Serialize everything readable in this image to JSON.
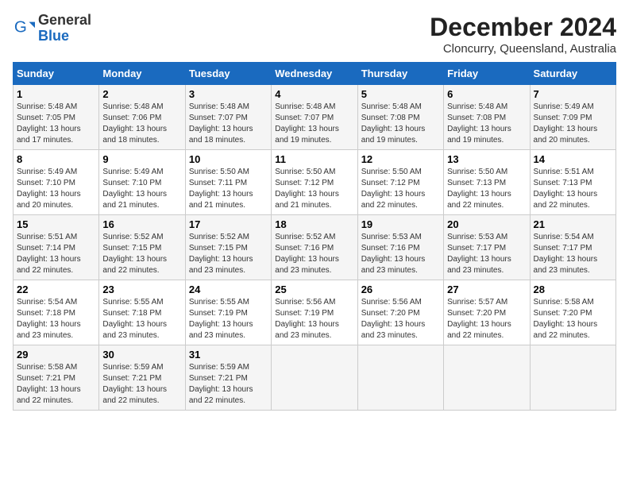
{
  "header": {
    "logo_line1": "General",
    "logo_line2": "Blue",
    "month_title": "December 2024",
    "location": "Cloncurry, Queensland, Australia"
  },
  "weekdays": [
    "Sunday",
    "Monday",
    "Tuesday",
    "Wednesday",
    "Thursday",
    "Friday",
    "Saturday"
  ],
  "weeks": [
    [
      {
        "day": "1",
        "sunrise": "5:48 AM",
        "sunset": "7:05 PM",
        "daylight": "13 hours and 17 minutes."
      },
      {
        "day": "2",
        "sunrise": "5:48 AM",
        "sunset": "7:06 PM",
        "daylight": "13 hours and 18 minutes."
      },
      {
        "day": "3",
        "sunrise": "5:48 AM",
        "sunset": "7:07 PM",
        "daylight": "13 hours and 18 minutes."
      },
      {
        "day": "4",
        "sunrise": "5:48 AM",
        "sunset": "7:07 PM",
        "daylight": "13 hours and 19 minutes."
      },
      {
        "day": "5",
        "sunrise": "5:48 AM",
        "sunset": "7:08 PM",
        "daylight": "13 hours and 19 minutes."
      },
      {
        "day": "6",
        "sunrise": "5:48 AM",
        "sunset": "7:08 PM",
        "daylight": "13 hours and 19 minutes."
      },
      {
        "day": "7",
        "sunrise": "5:49 AM",
        "sunset": "7:09 PM",
        "daylight": "13 hours and 20 minutes."
      }
    ],
    [
      {
        "day": "8",
        "sunrise": "5:49 AM",
        "sunset": "7:10 PM",
        "daylight": "13 hours and 20 minutes."
      },
      {
        "day": "9",
        "sunrise": "5:49 AM",
        "sunset": "7:10 PM",
        "daylight": "13 hours and 21 minutes."
      },
      {
        "day": "10",
        "sunrise": "5:50 AM",
        "sunset": "7:11 PM",
        "daylight": "13 hours and 21 minutes."
      },
      {
        "day": "11",
        "sunrise": "5:50 AM",
        "sunset": "7:12 PM",
        "daylight": "13 hours and 21 minutes."
      },
      {
        "day": "12",
        "sunrise": "5:50 AM",
        "sunset": "7:12 PM",
        "daylight": "13 hours and 22 minutes."
      },
      {
        "day": "13",
        "sunrise": "5:50 AM",
        "sunset": "7:13 PM",
        "daylight": "13 hours and 22 minutes."
      },
      {
        "day": "14",
        "sunrise": "5:51 AM",
        "sunset": "7:13 PM",
        "daylight": "13 hours and 22 minutes."
      }
    ],
    [
      {
        "day": "15",
        "sunrise": "5:51 AM",
        "sunset": "7:14 PM",
        "daylight": "13 hours and 22 minutes."
      },
      {
        "day": "16",
        "sunrise": "5:52 AM",
        "sunset": "7:15 PM",
        "daylight": "13 hours and 22 minutes."
      },
      {
        "day": "17",
        "sunrise": "5:52 AM",
        "sunset": "7:15 PM",
        "daylight": "13 hours and 23 minutes."
      },
      {
        "day": "18",
        "sunrise": "5:52 AM",
        "sunset": "7:16 PM",
        "daylight": "13 hours and 23 minutes."
      },
      {
        "day": "19",
        "sunrise": "5:53 AM",
        "sunset": "7:16 PM",
        "daylight": "13 hours and 23 minutes."
      },
      {
        "day": "20",
        "sunrise": "5:53 AM",
        "sunset": "7:17 PM",
        "daylight": "13 hours and 23 minutes."
      },
      {
        "day": "21",
        "sunrise": "5:54 AM",
        "sunset": "7:17 PM",
        "daylight": "13 hours and 23 minutes."
      }
    ],
    [
      {
        "day": "22",
        "sunrise": "5:54 AM",
        "sunset": "7:18 PM",
        "daylight": "13 hours and 23 minutes."
      },
      {
        "day": "23",
        "sunrise": "5:55 AM",
        "sunset": "7:18 PM",
        "daylight": "13 hours and 23 minutes."
      },
      {
        "day": "24",
        "sunrise": "5:55 AM",
        "sunset": "7:19 PM",
        "daylight": "13 hours and 23 minutes."
      },
      {
        "day": "25",
        "sunrise": "5:56 AM",
        "sunset": "7:19 PM",
        "daylight": "13 hours and 23 minutes."
      },
      {
        "day": "26",
        "sunrise": "5:56 AM",
        "sunset": "7:20 PM",
        "daylight": "13 hours and 23 minutes."
      },
      {
        "day": "27",
        "sunrise": "5:57 AM",
        "sunset": "7:20 PM",
        "daylight": "13 hours and 22 minutes."
      },
      {
        "day": "28",
        "sunrise": "5:58 AM",
        "sunset": "7:20 PM",
        "daylight": "13 hours and 22 minutes."
      }
    ],
    [
      {
        "day": "29",
        "sunrise": "5:58 AM",
        "sunset": "7:21 PM",
        "daylight": "13 hours and 22 minutes."
      },
      {
        "day": "30",
        "sunrise": "5:59 AM",
        "sunset": "7:21 PM",
        "daylight": "13 hours and 22 minutes."
      },
      {
        "day": "31",
        "sunrise": "5:59 AM",
        "sunset": "7:21 PM",
        "daylight": "13 hours and 22 minutes."
      },
      null,
      null,
      null,
      null
    ]
  ],
  "labels": {
    "sunrise": "Sunrise:",
    "sunset": "Sunset:",
    "daylight": "Daylight:"
  }
}
